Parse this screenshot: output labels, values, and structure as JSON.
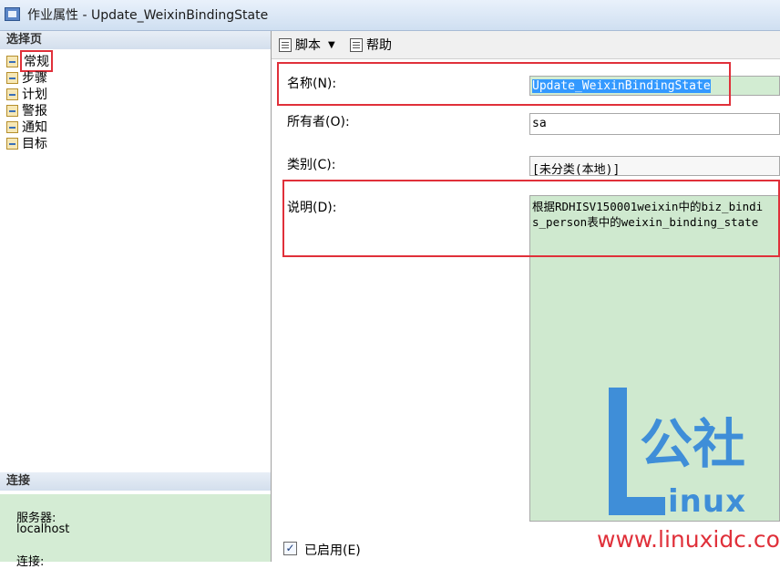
{
  "window": {
    "title": "作业属性 - Update_WeixinBindingState"
  },
  "left_panel": {
    "select_page_header": "选择页",
    "pages": [
      {
        "label": "常规",
        "icon": "page-icon",
        "selected": true
      },
      {
        "label": "步骤",
        "icon": "page-icon"
      },
      {
        "label": "计划",
        "icon": "page-icon"
      },
      {
        "label": "警报",
        "icon": "page-icon"
      },
      {
        "label": "通知",
        "icon": "page-icon"
      },
      {
        "label": "目标",
        "icon": "page-icon"
      }
    ],
    "connection_header": "连接",
    "server_label": "服务器:",
    "server_value": "localhost",
    "connection_label": "连接:"
  },
  "toolbar": {
    "script_label": "脚本",
    "help_label": "帮助"
  },
  "form": {
    "name_label": "名称(N):",
    "name_value": "Update_WeixinBindingState",
    "owner_label": "所有者(O):",
    "owner_value": "sa",
    "category_label": "类别(C):",
    "category_value": "[未分类(本地)]",
    "description_label": "说明(D):",
    "description_lines": [
      "根据RDHISV150001weixin中的biz_bindi",
      "s_person表中的weixin_binding_state"
    ],
    "enabled_label": "已启用(E)",
    "enabled": true
  },
  "watermark": {
    "cn_text": "公社",
    "en_text": "inux",
    "url": "www.linuxidc.com"
  },
  "colors": {
    "highlight_red": "#e0303a",
    "watermark_blue": "#3f8ed8",
    "field_green": "#d2ecd2",
    "selection_blue": "#3399ff"
  }
}
